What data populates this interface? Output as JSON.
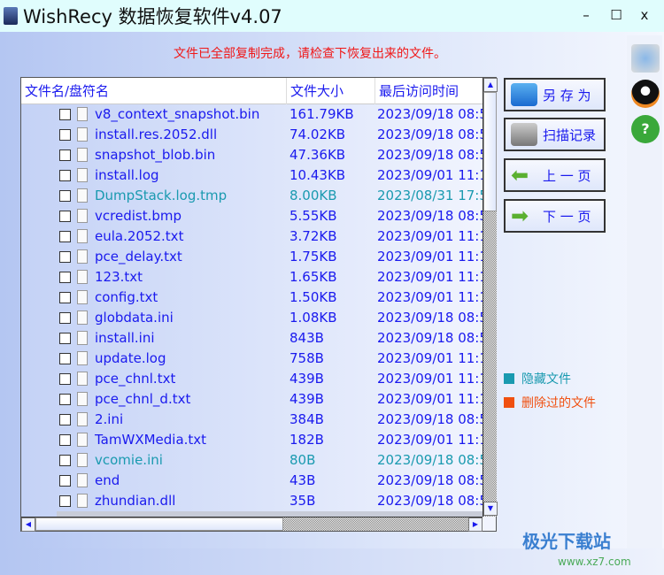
{
  "title": "WishRecy 数据恢复软件v4.07",
  "window_controls": {
    "minimize": "–",
    "maximize": "☐",
    "close": "x"
  },
  "message": "文件已全部复制完成，请检查下恢复出来的文件。",
  "columns": [
    "文件名/盘符名",
    "文件大小",
    "最后访问时间"
  ],
  "files": [
    {
      "name": "v8_context_snapshot.bin",
      "size": "161.79KB",
      "time": "2023/09/18 08:5",
      "teal": false
    },
    {
      "name": "install.res.2052.dll",
      "size": "74.02KB",
      "time": "2023/09/18 08:5",
      "teal": false
    },
    {
      "name": "snapshot_blob.bin",
      "size": "47.36KB",
      "time": "2023/09/18 08:5",
      "teal": false
    },
    {
      "name": "install.log",
      "size": "10.43KB",
      "time": "2023/09/01 11:1",
      "teal": false
    },
    {
      "name": "DumpStack.log.tmp",
      "size": "8.00KB",
      "time": "2023/08/31 17:5",
      "teal": true
    },
    {
      "name": "vcredist.bmp",
      "size": "5.55KB",
      "time": "2023/09/18 08:5",
      "teal": false
    },
    {
      "name": "eula.2052.txt",
      "size": "3.72KB",
      "time": "2023/09/01 11:1",
      "teal": false
    },
    {
      "name": "pce_delay.txt",
      "size": "1.75KB",
      "time": "2023/09/01 11:1",
      "teal": false
    },
    {
      "name": "123.txt",
      "size": "1.65KB",
      "time": "2023/09/01 11:1",
      "teal": false
    },
    {
      "name": "config.txt",
      "size": "1.50KB",
      "time": "2023/09/01 11:1",
      "teal": false
    },
    {
      "name": "globdata.ini",
      "size": "1.08KB",
      "time": "2023/09/18 08:5",
      "teal": false
    },
    {
      "name": "install.ini",
      "size": "843B",
      "time": "2023/09/18 08:5",
      "teal": false
    },
    {
      "name": "update.log",
      "size": "758B",
      "time": "2023/09/01 11:1",
      "teal": false
    },
    {
      "name": "pce_chnl.txt",
      "size": "439B",
      "time": "2023/09/01 11:1",
      "teal": false
    },
    {
      "name": "pce_chnl_d.txt",
      "size": "439B",
      "time": "2023/09/01 11:1",
      "teal": false
    },
    {
      "name": "2.ini",
      "size": "384B",
      "time": "2023/09/18 08:5",
      "teal": false
    },
    {
      "name": "TamWXMedia.txt",
      "size": "182B",
      "time": "2023/09/01 11:1",
      "teal": false
    },
    {
      "name": "vcomie.ini",
      "size": "80B",
      "time": "2023/09/18 08:5",
      "teal": true
    },
    {
      "name": "end",
      "size": "43B",
      "time": "2023/09/18 08:5",
      "teal": false
    },
    {
      "name": "zhundian.dll",
      "size": "35B",
      "time": "2023/09/18 08:5",
      "teal": false
    }
  ],
  "buttons": {
    "save_as": "另 存 为",
    "scan_record": "扫描记录",
    "prev_page": "上 一 页",
    "next_page": "下 一 页"
  },
  "legend": {
    "hidden": "隐藏文件",
    "deleted": "删除过的文件"
  },
  "colors": {
    "hidden": "#1a9ab0",
    "deleted": "#f05010",
    "text": "#1a1aee"
  },
  "watermark": {
    "name": "极光下载站",
    "url": "www.xz7.com"
  }
}
